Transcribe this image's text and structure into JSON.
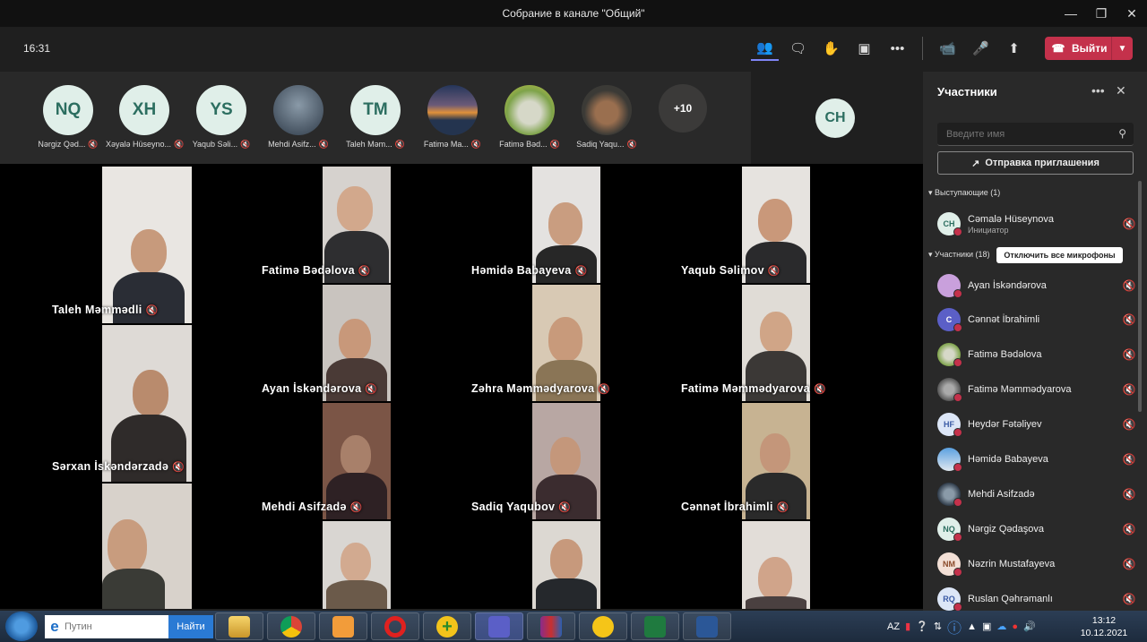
{
  "window": {
    "title": "Собрание в канале \"Общий\""
  },
  "toolbar": {
    "time": "16:31",
    "leave_label": "Выйти"
  },
  "strip": {
    "people": [
      {
        "initials": "NQ",
        "name": "Nərgiz Qəd..."
      },
      {
        "initials": "XH",
        "name": "Xəyalə Hüseyno..."
      },
      {
        "initials": "YS",
        "name": "Yaqub Səli..."
      },
      {
        "initials": "",
        "name": "Mehdi Asifz..."
      },
      {
        "initials": "TM",
        "name": "Taleh Məm..."
      },
      {
        "initials": "",
        "name": "Fatimə Ma..."
      },
      {
        "initials": "",
        "name": "Fatimə Bəd..."
      },
      {
        "initials": "",
        "name": "Sadiq Yaqu..."
      }
    ],
    "more": "+10",
    "speaker_initials": "CH"
  },
  "grid": {
    "tiles": [
      {
        "name": "Taleh Məmmədli"
      },
      {
        "name": "Fatimə Bədəlova"
      },
      {
        "name": "Həmidə Babayeva"
      },
      {
        "name": "Yaqub Səlimov"
      },
      {
        "name": "Sərxan İskəndərzadə"
      },
      {
        "name": "Ayan İskəndərova"
      },
      {
        "name": "Zəhra Məmmədyarova"
      },
      {
        "name": "Fatimə Məmmədyarova"
      },
      {
        "name": "Mehdi Asifzadə"
      },
      {
        "name": "Sadiq Yaqubov"
      },
      {
        "name": "Cənnət İbrahimli"
      }
    ]
  },
  "panel": {
    "title": "Участники",
    "search_placeholder": "Введите имя",
    "invite_label": "Отправка приглашения",
    "presenters_label": "Выступающие (1)",
    "presenter": {
      "initials": "CH",
      "name": "Cəmalə Hüseynova",
      "role": "Инициатор"
    },
    "attendees_label": "Участники (18)",
    "mute_all_label": "Отключить все микрофоны",
    "attendees": [
      {
        "initials": "",
        "name": "Ayan İskəndərova"
      },
      {
        "initials": "C",
        "name": "Cənnət İbrahimli"
      },
      {
        "initials": "",
        "name": "Fatimə Bədəlova"
      },
      {
        "initials": "",
        "name": "Fatimə Məmmədyarova"
      },
      {
        "initials": "HF",
        "name": "Heydər Fətəliyev"
      },
      {
        "initials": "",
        "name": "Həmidə Babayeva"
      },
      {
        "initials": "",
        "name": "Mehdi Asifzadə"
      },
      {
        "initials": "NQ",
        "name": "Nərgiz Qədaşova"
      },
      {
        "initials": "NM",
        "name": "Nəzrin Mustafayeva"
      },
      {
        "initials": "RQ",
        "name": "Ruslan Qəhrəmanlı"
      }
    ]
  },
  "taskbar": {
    "search_placeholder": "Путин",
    "search_button": "Найти",
    "language": "AZ",
    "time": "13:12",
    "date": "10.12.2021"
  },
  "colors": {
    "accent": "#7f85f5",
    "leave": "#c4314b",
    "panel_bg": "#292929"
  }
}
